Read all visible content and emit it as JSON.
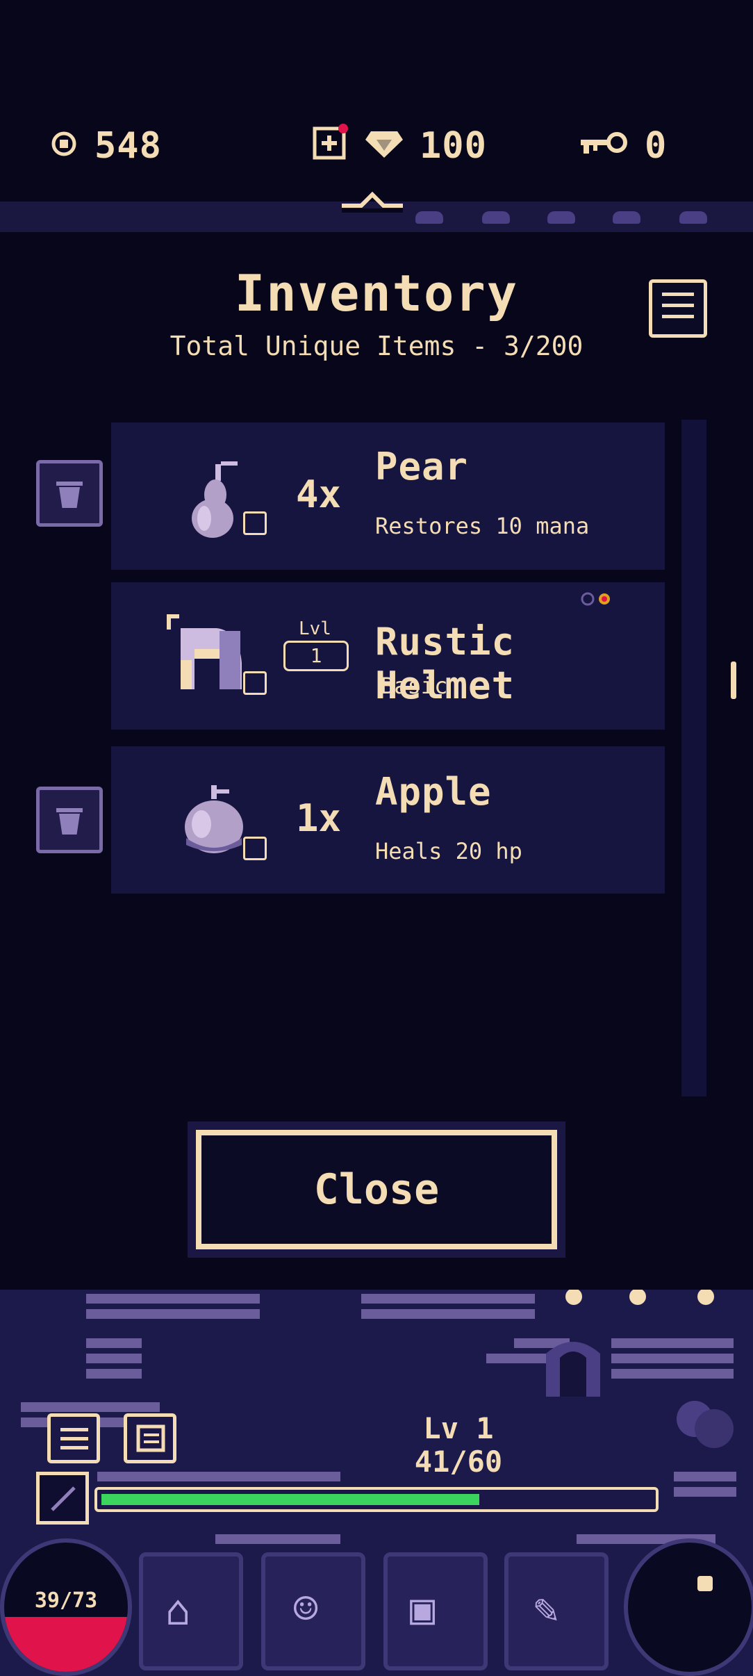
{
  "currencies": {
    "coins": "548",
    "gems": "100",
    "keys": "0"
  },
  "inventory": {
    "title": "Inventory",
    "subtitle": "Total Unique Items - 3/200",
    "items": [
      {
        "name": "Pear",
        "qty": "4x",
        "desc": "Restores 10 mana",
        "icon": "pear-icon"
      },
      {
        "name": "Rustic Helmet",
        "level_label": "Lvl",
        "level": "1",
        "desc": "Basic",
        "icon": "helmet-icon"
      },
      {
        "name": "Apple",
        "qty": "1x",
        "desc": "Heals 20 hp",
        "icon": "apple-icon"
      }
    ],
    "close_label": "Close"
  },
  "hud": {
    "level_text": "Lv 1",
    "xp_text": "41/60",
    "xp_fraction": 0.683,
    "hp_text": "39/73",
    "hp_fraction": 0.534
  },
  "colors": {
    "background": "#07061a",
    "text": "#f4ddb4",
    "panel": "#16153f",
    "xp_fill": "#3bd45c",
    "hp_fill": "#e0144b"
  }
}
